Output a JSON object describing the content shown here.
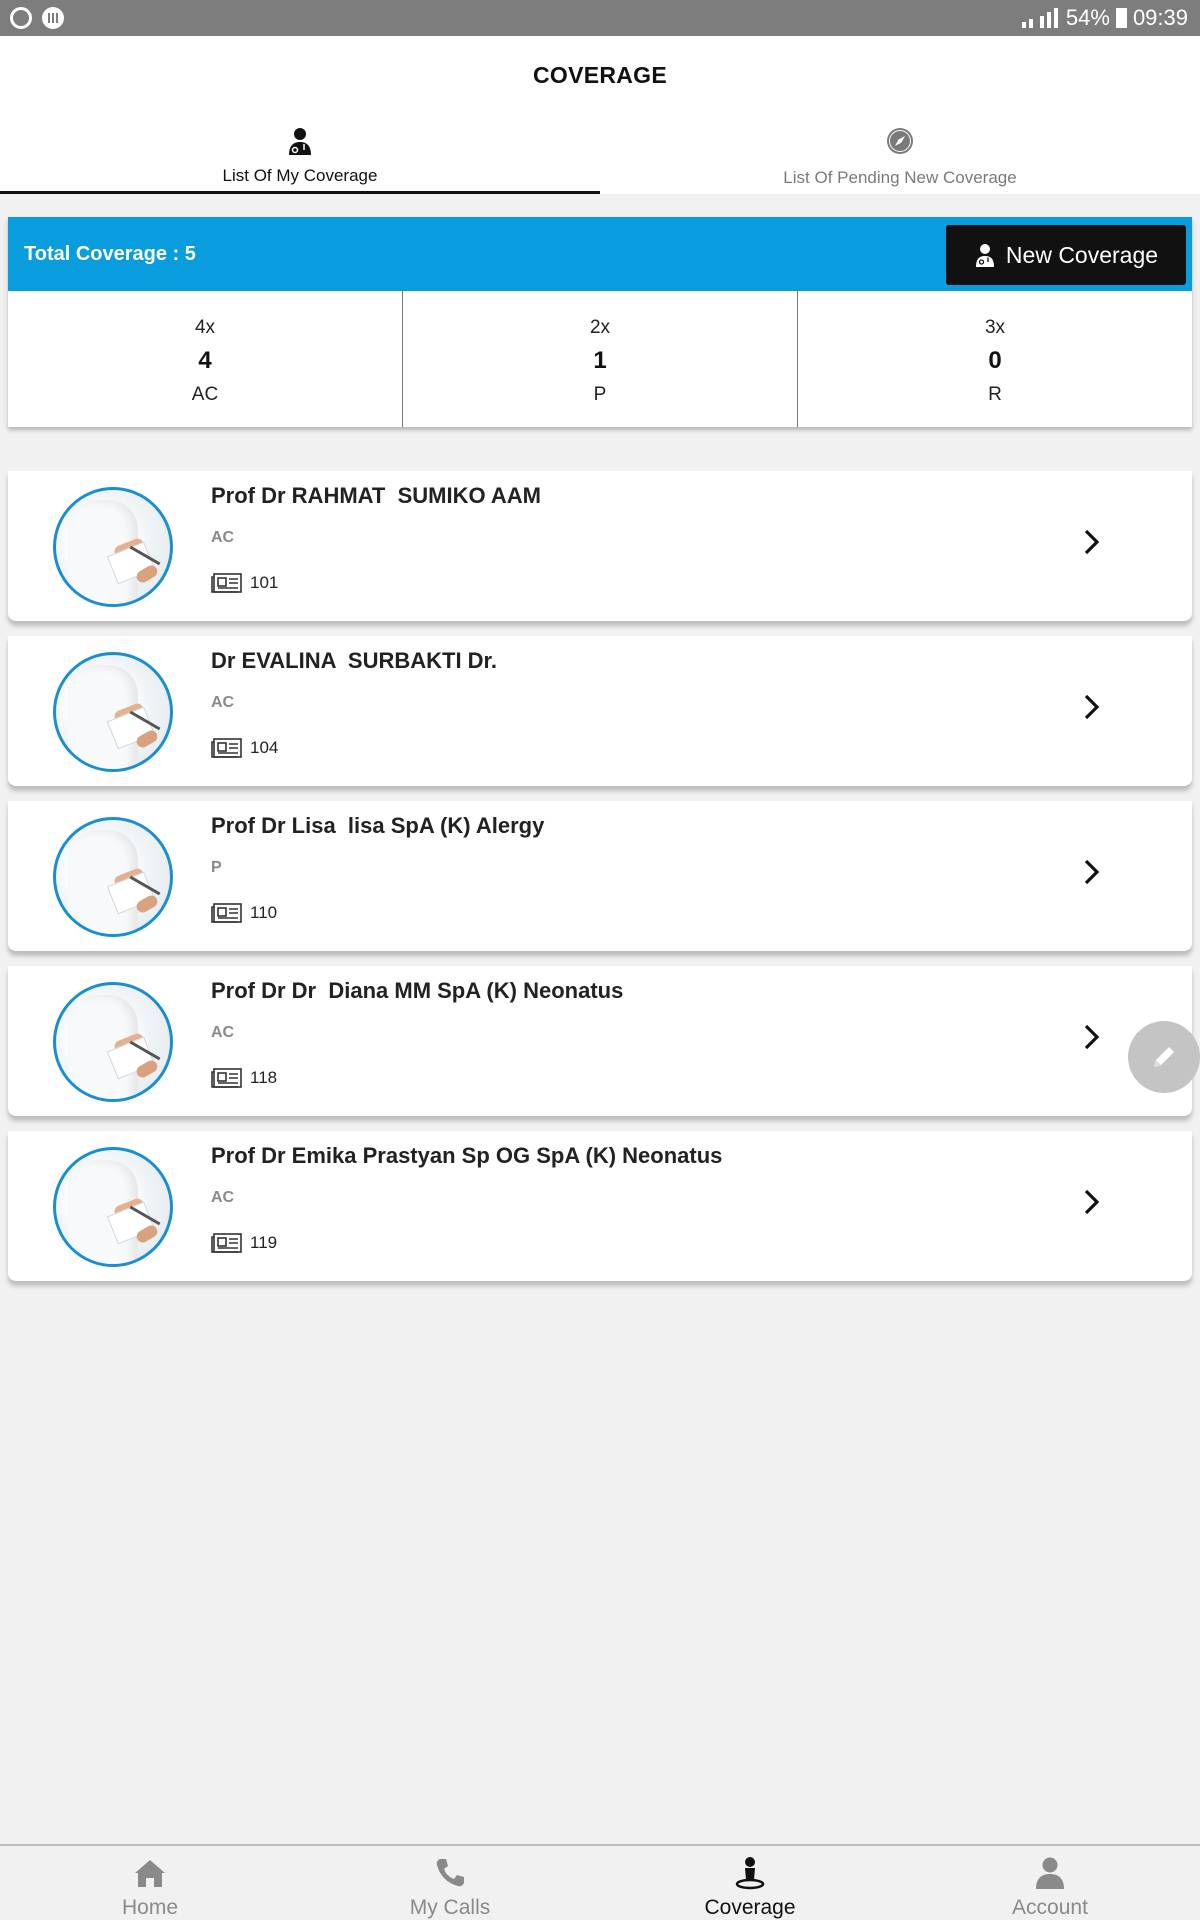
{
  "status_bar": {
    "battery": "54%",
    "time": "09:39"
  },
  "header": {
    "title": "COVERAGE",
    "tabs": [
      {
        "label": "List Of My Coverage",
        "icon": "doctor-icon",
        "active": true
      },
      {
        "label": "List Of Pending New Coverage",
        "icon": "compass-icon",
        "active": false
      }
    ]
  },
  "summary": {
    "total_label": "Total Coverage : 5",
    "new_button_label": "New Coverage",
    "stats": [
      {
        "freq": "4x",
        "count": "4",
        "code": "AC"
      },
      {
        "freq": "2x",
        "count": "1",
        "code": "P"
      },
      {
        "freq": "3x",
        "count": "0",
        "code": "R"
      }
    ]
  },
  "doctors": [
    {
      "name": "Prof Dr RAHMAT  SUMIKO AAM",
      "status": "AC",
      "id": "101"
    },
    {
      "name": "Dr EVALINA  SURBAKTI Dr.",
      "status": "AC",
      "id": "104"
    },
    {
      "name": "Prof Dr Lisa  lisa SpA (K) Alergy",
      "status": "P",
      "id": "110"
    },
    {
      "name": "Prof Dr Dr  Diana MM SpA (K) Neonatus",
      "status": "AC",
      "id": "118"
    },
    {
      "name": "Prof Dr Emika Prastyan Sp OG SpA (K) Neonatus",
      "status": "AC",
      "id": "119"
    }
  ],
  "bottom_nav": [
    {
      "label": "Home",
      "icon": "home-icon",
      "active": false
    },
    {
      "label": "My Calls",
      "icon": "phone-icon",
      "active": false
    },
    {
      "label": "Coverage",
      "icon": "coverage-icon",
      "active": true
    },
    {
      "label": "Account",
      "icon": "account-icon",
      "active": false
    }
  ],
  "colors": {
    "accent": "#0a9ddd",
    "button": "#111111",
    "avatar_ring": "#1a8fd0"
  }
}
